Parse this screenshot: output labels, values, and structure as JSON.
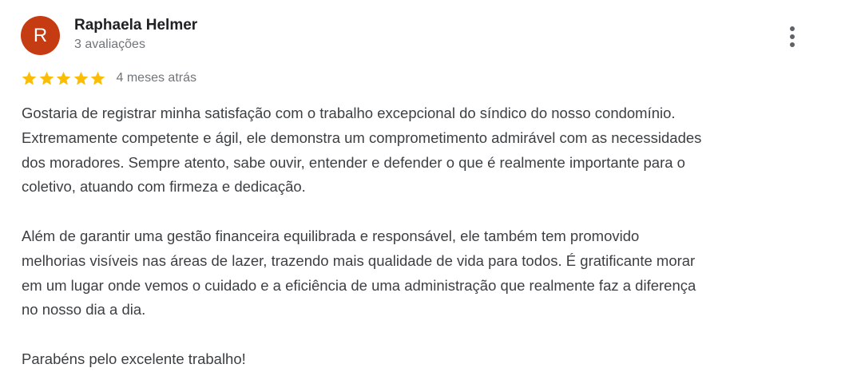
{
  "review": {
    "avatar_letter": "R",
    "avatar_color": "#c53b12",
    "author_name": "Raphaela Helmer",
    "review_count": "3 avaliações",
    "rating": 5,
    "rating_max": 5,
    "star_color": "#fbbc04",
    "date": "4 meses atrás",
    "more_icon": "more-vert-icon",
    "paragraphs": [
      "Gostaria de registrar minha satisfação com o trabalho excepcional do síndico do nosso condomínio.\nExtremamente competente e ágil, ele demonstra um comprometimento admirável com as necessidades\ndos moradores. Sempre atento, sabe ouvir, entender e defender o que é realmente importante para o\ncoletivo, atuando com firmeza e dedicação.",
      "Além de garantir uma gestão financeira equilibrada e responsável, ele também tem promovido\nmelhorias visíveis nas áreas de lazer, trazendo mais qualidade de vida para todos. É gratificante morar\nem um lugar onde vemos o cuidado e a eficiência de uma administração que realmente faz a diferença\nno nosso dia a dia.",
      "Parabéns pelo excelente trabalho!"
    ]
  }
}
